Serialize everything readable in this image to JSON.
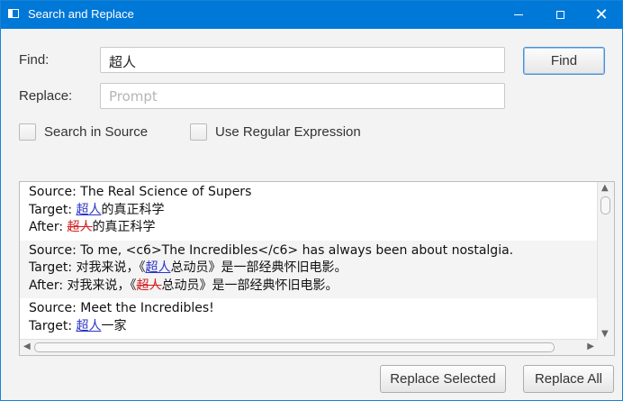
{
  "window": {
    "title": "Search and Replace",
    "close_glyph": "✕"
  },
  "find": {
    "label": "Find:",
    "value": "超人",
    "button_label": "Find"
  },
  "replace": {
    "label": "Replace:",
    "placeholder": "Prompt"
  },
  "options": {
    "search_in_source": "Search in Source",
    "use_regex": "Use Regular Expression"
  },
  "results": [
    {
      "source_prefix": "Source: ",
      "source": "The Real Science of Supers",
      "target_prefix": "Target: ",
      "target_hl": "超人",
      "target_rest": "的真正科学",
      "target_pre": "",
      "after_prefix": "After: ",
      "after_hl": "超人",
      "after_rest": "的真正科学",
      "after_pre": ""
    },
    {
      "source_prefix": "Source: ",
      "source": "To me, <c6>The Incredibles</c6> has always been about nostalgia.",
      "target_prefix": "Target: ",
      "target_pre": "对我来说，《",
      "target_hl": "超人",
      "target_rest": "总动员》是一部经典怀旧电影。",
      "after_prefix": "After: ",
      "after_pre": "对我来说，《",
      "after_hl": "超人",
      "after_rest": "总动员》是一部经典怀旧电影。"
    },
    {
      "source_prefix": "Source: ",
      "source": "Meet the Incredibles!",
      "target_prefix": "Target: ",
      "target_pre": "",
      "target_hl": "超人",
      "target_rest": "一家"
    }
  ],
  "actions": {
    "replace_selected": "Replace Selected",
    "replace_all": "Replace All"
  },
  "colors": {
    "titlebar": "#0078d7",
    "match_highlight": "#2a34c9",
    "replaced_highlight": "#d42020"
  }
}
